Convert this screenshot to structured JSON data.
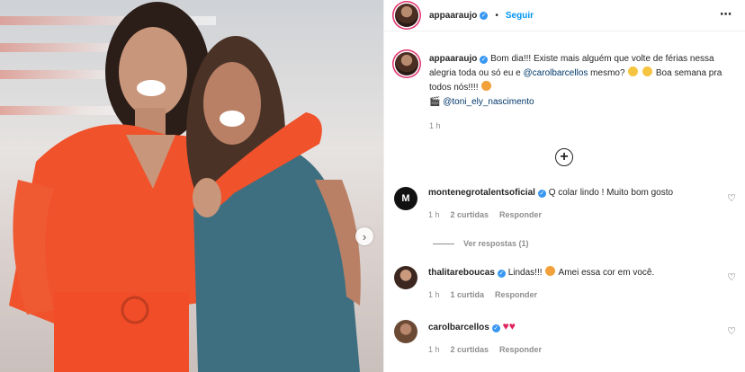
{
  "post": {
    "username": "appaaraujo",
    "follow_label": "Seguir",
    "separator": "•",
    "more_icon": "⋯",
    "caption": {
      "username": "appaaraujo",
      "text_1": "Bom dia!!! Existe mais alguém que volte de férias nessa alegria toda ou só eu e",
      "mention_1": "@carolbarcellos",
      "text_2": "mesmo?",
      "text_3": "Boa semana pra todos nós!!!!",
      "camera_icon": "🎬",
      "credit_mention": "@toni_ely_nascimento",
      "time": "1 h"
    }
  },
  "load_more_icon": "+",
  "next_icon": "›",
  "comments": [
    {
      "username": "montenegrotalentsoficial",
      "text": "Q colar lindo ! Muito bom gosto",
      "time": "1 h",
      "likes": "2 curtidas",
      "reply": "Responder",
      "avatar_label": "M"
    },
    {
      "username": "thalitareboucas",
      "text": "Lindas!!!",
      "text_after": "Amei essa cor em você.",
      "time": "1 h",
      "likes": "1 curtida",
      "reply": "Responder"
    },
    {
      "username": "carolbarcellos",
      "text": "",
      "time": "1 h",
      "likes": "2 curtidas",
      "reply": "Responder"
    }
  ],
  "view_replies": "Ver respostas (1)",
  "colors": {
    "accent_blue": "#0095f6",
    "verified_blue": "#3897f0",
    "orange_outfit": "#f0522c",
    "teal_dress": "#3e6f80"
  }
}
